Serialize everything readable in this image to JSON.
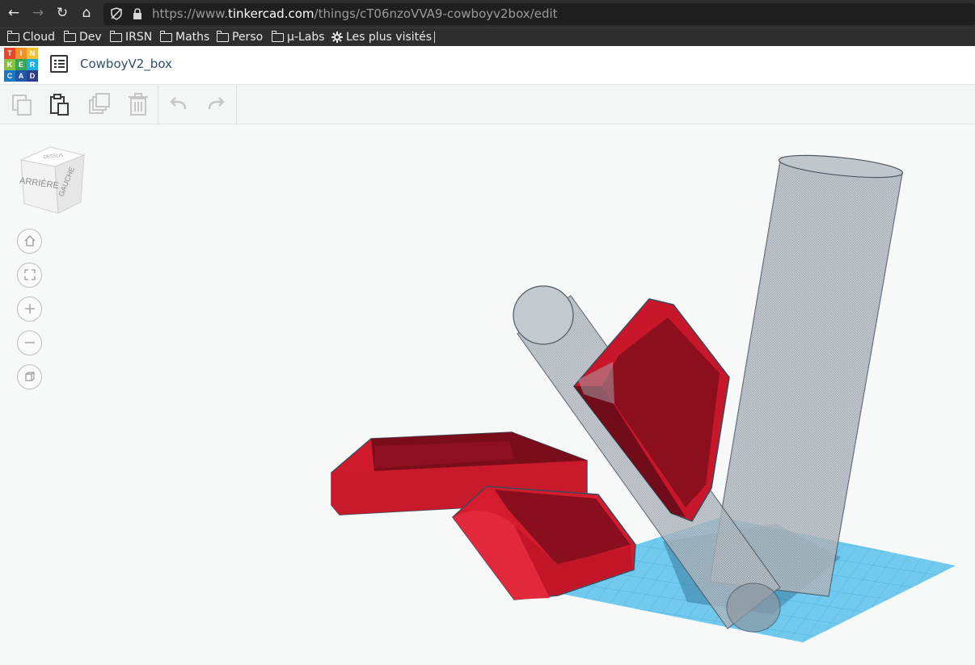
{
  "browser": {
    "url_scheme": "https://www.",
    "url_host": "tinkercad.com",
    "url_path": "/things/cT06nzoVVA9-cowboyv2box/edit",
    "back_icon": "←",
    "forward_icon": "→",
    "reload_icon": "↻",
    "home_icon": "⌂"
  },
  "bookmarks": [
    {
      "label": "Cloud"
    },
    {
      "label": "Dev"
    },
    {
      "label": "IRSN"
    },
    {
      "label": "Maths"
    },
    {
      "label": "Perso"
    },
    {
      "label": "µ-Labs"
    },
    {
      "label": "Les plus visités"
    }
  ],
  "app": {
    "logo_letters": [
      "T",
      "I",
      "N",
      "K",
      "E",
      "R",
      "C",
      "A",
      "D"
    ],
    "document_title": "CowboyV2_box"
  },
  "viewcube": {
    "face_back": "ARRIÈRE",
    "face_left": "GAUCHE",
    "face_top": "DESSUS"
  },
  "colors": {
    "accent": "#2f4f6f",
    "shape_red": "#d81f2f",
    "hole_gray": "#9aa3ab",
    "workplane_blue": "#4ab7e6"
  }
}
